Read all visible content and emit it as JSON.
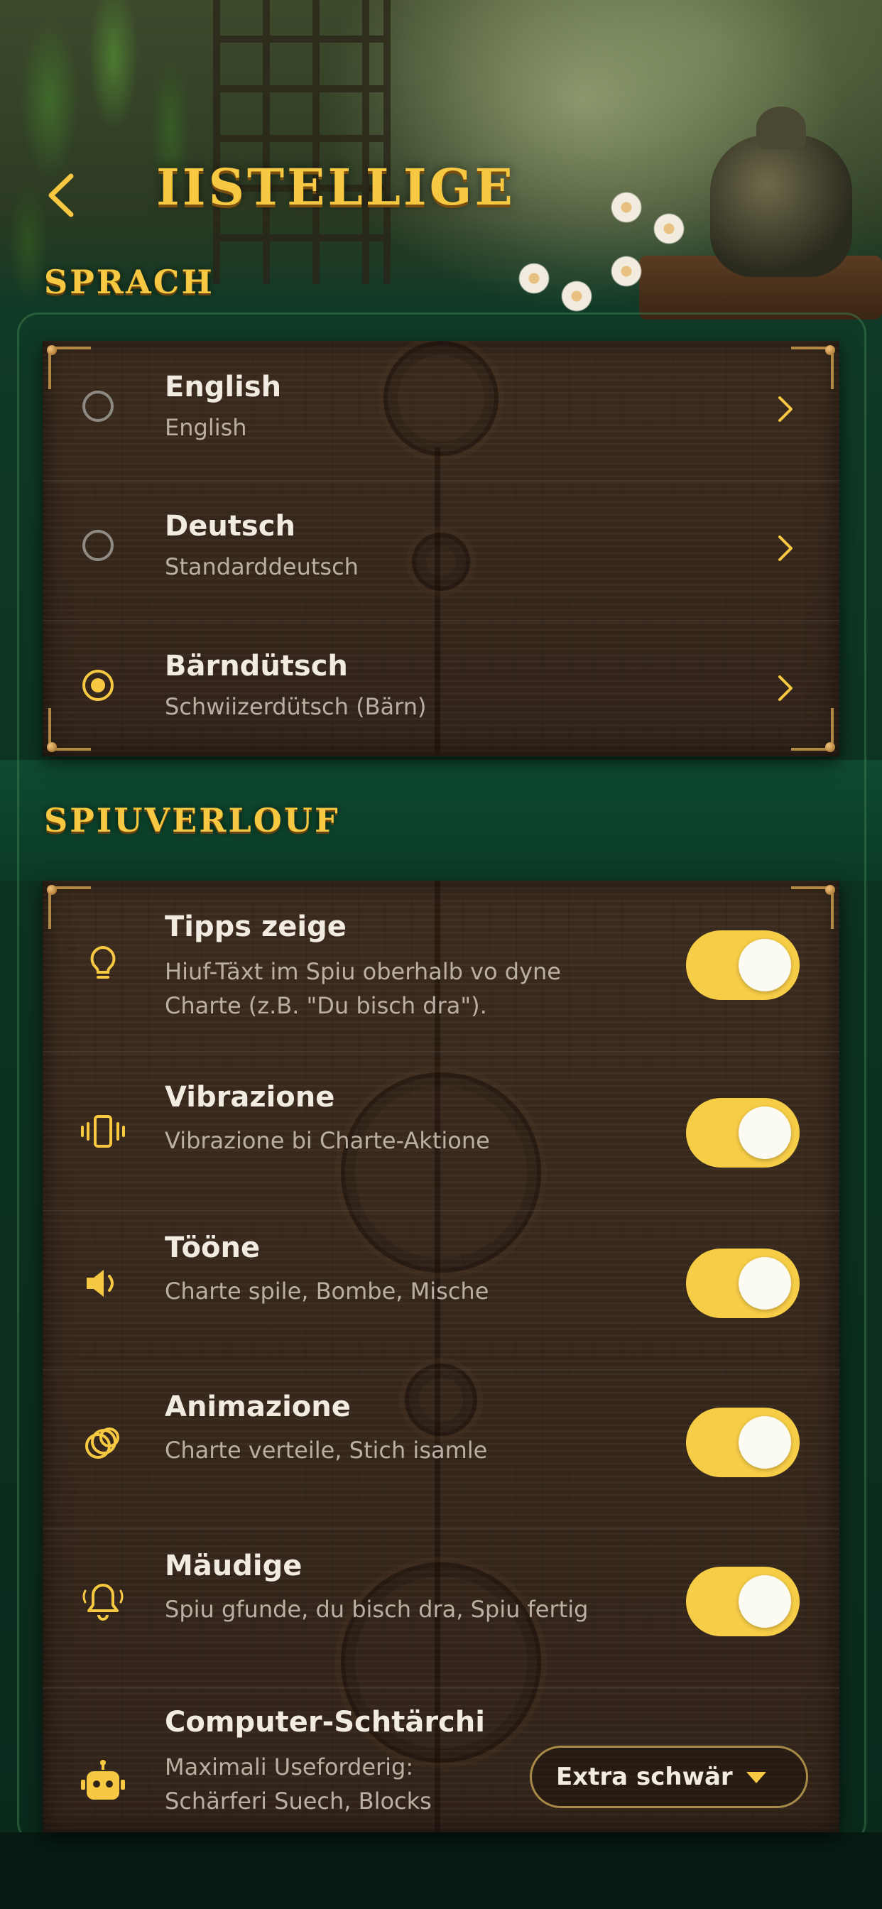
{
  "header": {
    "title": "IISTELLIGE",
    "back_icon": "chevron-left-icon"
  },
  "language_section": {
    "title": "SPRACH",
    "items": [
      {
        "label": "English",
        "sublabel": "English",
        "selected": false
      },
      {
        "label": "Deutsch",
        "sublabel": "Standarddeutsch",
        "selected": false
      },
      {
        "label": "Bärndütsch",
        "sublabel": "Schwiizerdütsch (Bärn)",
        "selected": true
      }
    ]
  },
  "gameplay_section": {
    "title": "SPIUVERLOUF",
    "items": [
      {
        "icon": "lightbulb-icon",
        "label": "Tipps zeige",
        "sublabel_lines": [
          "Hiuf-Täxt im Spiu oberhalb vo dyne",
          "Charte (z.B. \"Du bisch dra\")."
        ],
        "enabled": true
      },
      {
        "icon": "vibration-icon",
        "label": "Vibrazione",
        "sublabel_lines": [
          "Vibrazione bi Charte-Aktione"
        ],
        "enabled": true
      },
      {
        "icon": "speaker-icon",
        "label": "Tööne",
        "sublabel_lines": [
          "Charte spile, Bombe, Mische"
        ],
        "enabled": true
      },
      {
        "icon": "rings-icon",
        "label": "Animazione",
        "sublabel_lines": [
          "Charte verteile, Stich isamle"
        ],
        "enabled": true
      },
      {
        "icon": "bell-icon",
        "label": "Mäudige",
        "sublabel_lines": [
          "Spiu gfunde, du bisch dra, Spiu fertig"
        ],
        "enabled": true
      }
    ],
    "difficulty": {
      "icon": "robot-icon",
      "label": "Computer-Schtärchi",
      "sublabel_lines": [
        "Maximali Useforderig:",
        "Schärferi Suech, Blocks"
      ],
      "selected_value": "Extra schwär"
    }
  },
  "colors": {
    "accent": "#f7c842",
    "toggle_on": "#f6cd47",
    "wood": "#3a2a1d",
    "background_green": "#0d3322"
  }
}
